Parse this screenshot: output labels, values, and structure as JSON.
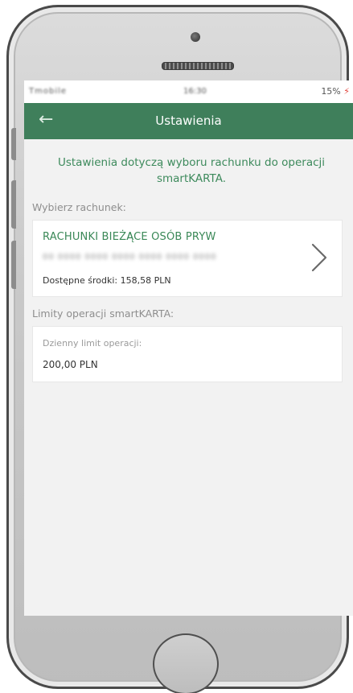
{
  "status_bar": {
    "carrier": "Tmobile",
    "time": "16:30",
    "battery": "15%"
  },
  "app_bar": {
    "back_icon": "arrow-left-icon",
    "title": "Ustawienia"
  },
  "info": {
    "text": "Ustawienia dotyczą wyboru rachunku do operacji smartKARTA."
  },
  "account_section": {
    "label": "Wybierz rachunek:",
    "account_name": "RACHUNKI BIEŻĄCE OSÓB PRYW",
    "account_number": "00 0000 0000 0000 0000 0000 0000",
    "balance": "Dostępne środki: 158,58 PLN",
    "chevron_icon": "chevron-right-icon"
  },
  "limits_section": {
    "label": "Limity operacji smartKARTA:",
    "daily_limit_label": "Dzienny limit operacji:",
    "daily_limit_value": "200,00 PLN"
  },
  "colors": {
    "primary_green": "#3f7f5b",
    "text_green": "#3d8a5c",
    "background": "#f2f2f2"
  }
}
